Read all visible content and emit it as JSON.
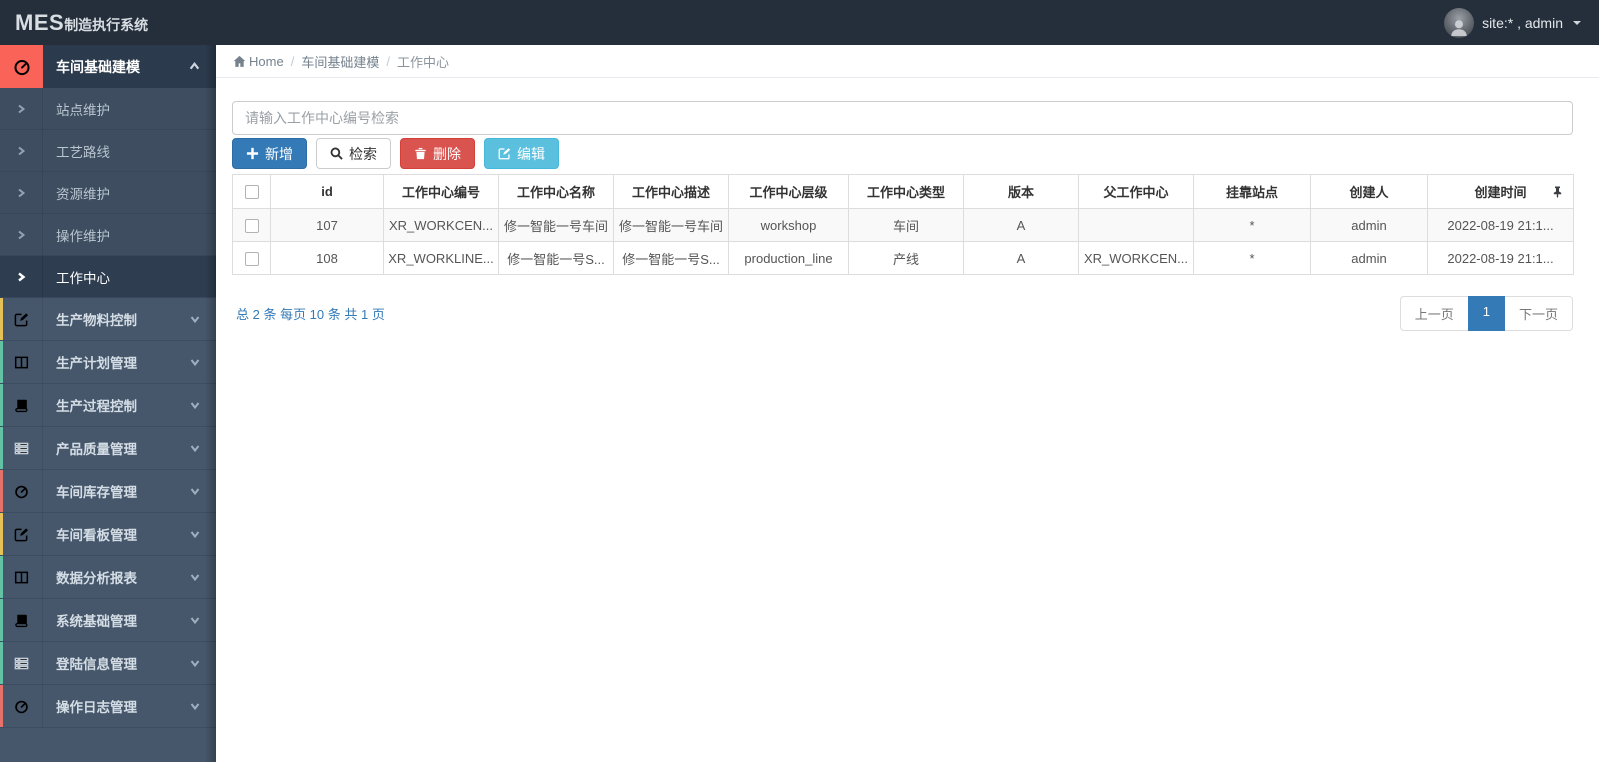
{
  "navbar": {
    "logo_bold": "MES",
    "logo_rest": "制造执行系统",
    "user_label": "site:* , admin",
    "user_avatar_icon": "user-photo-avatar",
    "color": "#252e3b"
  },
  "sidebar": {
    "section": {
      "label": "车间基础建模",
      "icon": "dashboard-icon",
      "icon_bg": "#f96358",
      "chevron": "chevron-up-icon"
    },
    "submenu": [
      {
        "label": "站点维护",
        "icon": "chevron-right-icon",
        "active": false
      },
      {
        "label": "工艺路线",
        "icon": "chevron-right-icon",
        "active": false
      },
      {
        "label": "资源维护",
        "icon": "chevron-right-icon",
        "active": false
      },
      {
        "label": "操作维护",
        "icon": "chevron-right-icon",
        "active": false
      },
      {
        "label": "工作中心",
        "icon": "chevron-right-icon",
        "active": true
      }
    ],
    "items": [
      {
        "label": "生产物料控制",
        "icon": "edit-icon",
        "strip_color": "#e5c158"
      },
      {
        "label": "生产计划管理",
        "icon": "columns-icon",
        "strip_color": "#63c2a3"
      },
      {
        "label": "生产过程控制",
        "icon": "book-icon",
        "strip_color": "#63c2a3"
      },
      {
        "label": "产品质量管理",
        "icon": "list-icon",
        "strip_color": "#63c2a3"
      },
      {
        "label": "车间库存管理",
        "icon": "dashboard-icon",
        "strip_color": "#e4726a"
      },
      {
        "label": "车间看板管理",
        "icon": "edit-icon",
        "strip_color": "#e5c158"
      },
      {
        "label": "数据分析报表",
        "icon": "columns-icon",
        "strip_color": "#63c2a3"
      },
      {
        "label": "系统基础管理",
        "icon": "book-icon",
        "strip_color": "#63c2a3"
      },
      {
        "label": "登陆信息管理",
        "icon": "list-icon",
        "strip_color": "#63c2a3"
      },
      {
        "label": "操作日志管理",
        "icon": "dashboard-icon",
        "strip_color": "#e4726a"
      }
    ]
  },
  "breadcrumb": {
    "home": "Home",
    "home_icon": "home-icon",
    "items": [
      "车间基础建模",
      "工作中心"
    ]
  },
  "search": {
    "placeholder": "请输入工作中心编号检索"
  },
  "toolbar": {
    "add": {
      "label": "新增",
      "icon": "plus-icon",
      "color": "#337ab7"
    },
    "search": {
      "label": "检索",
      "icon": "search-icon",
      "color": "#ffffff"
    },
    "delete": {
      "label": "删除",
      "icon": "trash-icon",
      "color": "#d9534f"
    },
    "edit": {
      "label": "编辑",
      "icon": "edit-icon",
      "color": "#5bc0de"
    }
  },
  "table": {
    "columns": [
      "id",
      "工作中心编号",
      "工作中心名称",
      "工作中心描述",
      "工作中心层级",
      "工作中心类型",
      "版本",
      "父工作中心",
      "挂靠站点",
      "创建人",
      "创建时间"
    ],
    "pin_icon": "pushpin-icon",
    "rows": [
      {
        "cells": [
          "107",
          "XR_WORKCEN...",
          "修一智能一号车间",
          "修一智能一号车间",
          "workshop",
          "车间",
          "A",
          "",
          "*",
          "admin",
          "2022-08-19 21:1..."
        ]
      },
      {
        "cells": [
          "108",
          "XR_WORKLINE...",
          "修一智能一号S...",
          "修一智能一号S...",
          "production_line",
          "产线",
          "A",
          "XR_WORKCEN...",
          "*",
          "admin",
          "2022-08-19 21:1..."
        ]
      }
    ]
  },
  "pagination": {
    "summary": "总 2 条 每页 10 条 共 1 页",
    "prev": "上一页",
    "page": "1",
    "next": "下一页",
    "active_color": "#337ab7"
  }
}
